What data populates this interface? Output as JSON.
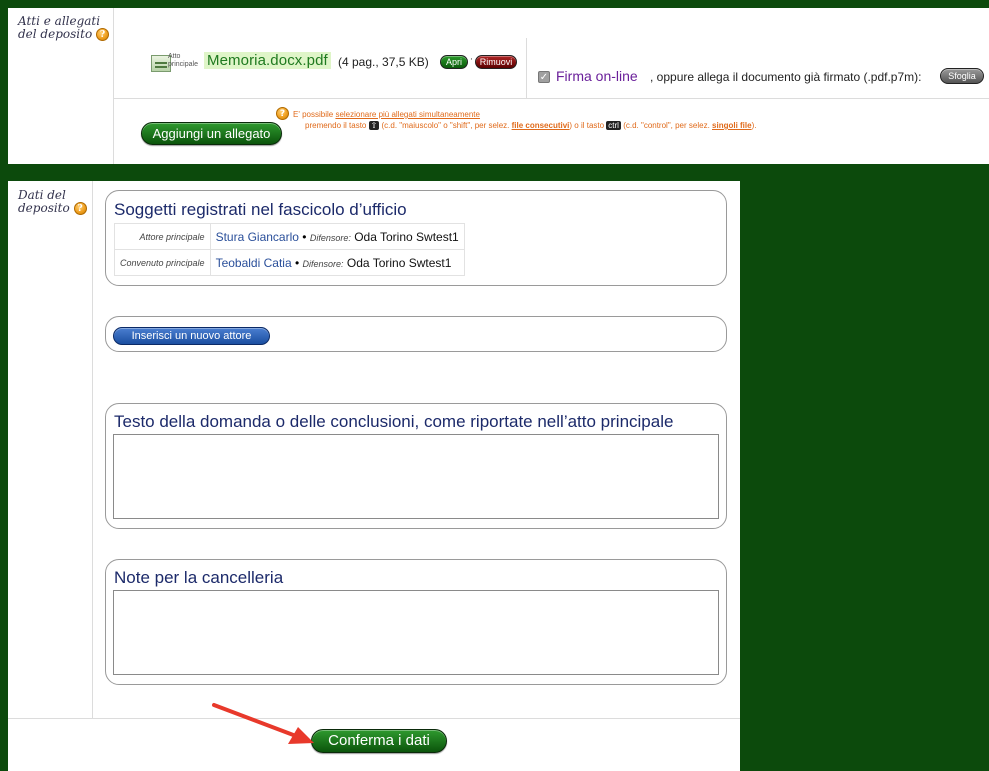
{
  "atti_section": {
    "label_line1": "Atti e allegati",
    "label_line2": "del deposito",
    "file": {
      "icon": "document-icon",
      "caption_line1": "Atto",
      "caption_line2": "principale",
      "name": "Memoria.docx.pdf",
      "meta": "(4 pag., 37,5 KB)"
    },
    "apri_label": "Apri",
    "rimuovi_label": "Rimuovi",
    "firma": {
      "checked": true,
      "label": "Firma on-line",
      "rest": ", oppure allega il documento già firmato (.pdf.p7m):",
      "sfoglia_label": "Sfoglia"
    },
    "aggiungi_label": "Aggiungi un allegato",
    "hint": {
      "line1_prefix": "E' possibile ",
      "line1_link": "selezionare più allegati simultaneamente",
      "line2_a": "premendo il tasto ",
      "key1": "⇧",
      "line2_b": " (c.d. \"maiuscolo\" o \"shift\", per selez. ",
      "link_consecutivi": "file consecutivi",
      "line2_c": ") o il tasto ",
      "key2": "ctrl",
      "line2_d": " (c.d. \"control\", per selez. ",
      "link_singoli": "singoli file",
      "line2_e": ")."
    }
  },
  "dati_section": {
    "label_line1": "Dati del",
    "label_line2": "deposito",
    "soggetti": {
      "title": "Soggetti registrati nel fascicolo d’ufficio",
      "rows": [
        {
          "role": "Attore principale",
          "name": "Stura Giancarlo",
          "dif_label": "Difensore:",
          "dif_name": "Oda Torino Swtest1"
        },
        {
          "role": "Convenuto principale",
          "name": "Teobaldi Catia",
          "dif_label": "Difensore:",
          "dif_name": "Oda Torino Swtest1"
        }
      ]
    },
    "inserisci_label": "Inserisci un nuovo attore",
    "testo": {
      "title": "Testo della domanda o delle conclusioni, come riportate nell’atto principale",
      "value": ""
    },
    "note": {
      "title": "Note per la cancelleria",
      "value": ""
    },
    "conferma_label": "Conferma i dati"
  },
  "colors": {
    "frame_green": "#0c4a0c",
    "button_green": "#1f7a1f",
    "title_blue": "#1c2a6a",
    "arrow_red": "#e8392b"
  }
}
